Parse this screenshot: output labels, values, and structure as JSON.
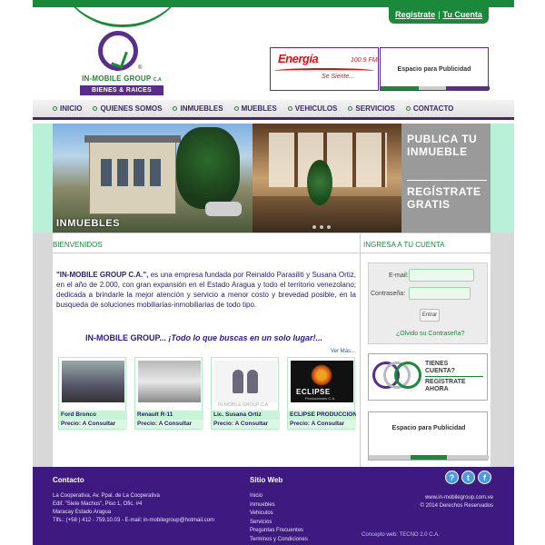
{
  "auth": {
    "register": "Regístrate",
    "separator": "|",
    "account": "Tu Cuenta"
  },
  "logo": {
    "name": "IN-MOBILE GROUP",
    "suffix": "C.A",
    "tagline": "BIENES & RAICES",
    "registered": "®"
  },
  "banners": {
    "radio_name": "Energía",
    "radio_freq": "100.9 FM",
    "radio_slogan": "Se Siente...",
    "ad_label": "Espacio para Publicidad"
  },
  "nav": {
    "items": [
      {
        "label": "INICIO"
      },
      {
        "label": "QUIENES SOMOS"
      },
      {
        "label": "INMUEBLES"
      },
      {
        "label": "MUEBLES"
      },
      {
        "label": "VEHICULOS"
      },
      {
        "label": "SERVICIOS"
      },
      {
        "label": "CONTACTO"
      }
    ]
  },
  "hero": {
    "caption": "INMUEBLES",
    "promo_1": "PUBLICA TU INMUEBLE",
    "promo_2": "REGÍSTRATE GRATIS"
  },
  "main": {
    "title": "BIENVENIDOS",
    "intro_company": "\"IN-MOBILE GROUP C.A.\",",
    "intro_text": " es una empresa fundada por Reinaldo Parasiliti y Susana Ortiz, en el año de 2.000, con gran expansión en el Estado Aragua y todo el territorio venezolano; dedicada a brindarle la mejor atención y servicio a menor costo y brevedad posible, en la busqueda de soluciones mobiliarias-inmobiliarias de todo tipo.",
    "tagline_brand": "IN-MOBILE GROUP...",
    "tagline_text": " ¡Todo lo que buscas en un solo lugar!...",
    "more": "Ver Más...",
    "cards": [
      {
        "title": "Ford Bronco",
        "price": "Precio: A Consultar"
      },
      {
        "title": "Renault R-11",
        "price": "Precio: A Consultar"
      },
      {
        "title": "Lic. Susana Ortiz",
        "price": "Precio: A Consultar",
        "watermark": "IN-MOBILE GROUP C.A"
      },
      {
        "title": "ECLIPSE PRODUCCIONES",
        "price": "Precio: A Consultar",
        "logo_word": "ECLIPSE",
        "logo_sub": "Producciones C.A."
      }
    ]
  },
  "login": {
    "title": "INGRESA A TU CUENTA",
    "email_label": "E-mail:",
    "password_label": "Contraseña:",
    "submit": "Entrar",
    "forgot": "¿Olvido su Contraseña?",
    "reg_line1": "TIENES",
    "reg_line2": "CUENTA?",
    "reg_line3": "REGÍSTRATE",
    "reg_line4": "AHORA",
    "ad_label": "Espacio para Publicidad"
  },
  "footer": {
    "contact_title": "Contacto",
    "address_1": "La Cooperativa, Av. Ppal. de La Cooperativa",
    "address_2": "Edif. \"Siete Machos\", Piso 1, Ofic. #4",
    "address_3": "Maracay Estado Aragua",
    "phone": "Tlfs.: (+58 ) 412 - 759.10.03 - E-mail: in-mobilegroup@hotmail.com",
    "site_title": "Sitio Web",
    "site_links": [
      "Inicio",
      "Inmuebles",
      "Vehiculos",
      "Servicios",
      "Preguntas Frecuentes",
      "Terminos y Condiciones"
    ],
    "website": "www.in-mobilegroup.com.ve",
    "copyright": "© 2014 Derechos Reservados",
    "credit": "Concepto web: TECNO 2.0 C.A."
  }
}
